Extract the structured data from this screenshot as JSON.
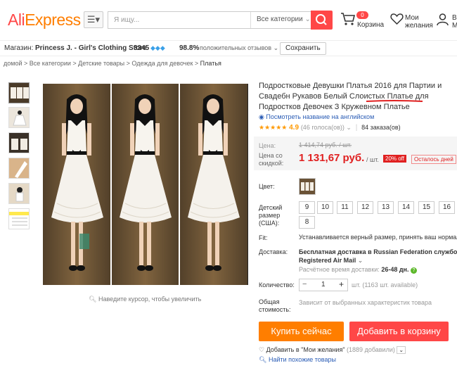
{
  "header": {
    "logo": "AliExpress",
    "search_placeholder": "Я ищу...",
    "category_select": "Все категории",
    "cart_count": "0",
    "cart_label": "Корзина",
    "wishlist_label_1": "Мои",
    "wishlist_label_2": "желания",
    "account_label_1": "В",
    "account_label_2": "М",
    "brand_color": "#ff4747"
  },
  "store": {
    "prefix": "Магазин:",
    "name": "Princess J. - Girl's Clothing Store",
    "score": "3345",
    "positive": "98.8%",
    "positive_label": "положительных отзывов",
    "save_label": "Сохранить"
  },
  "breadcrumb": [
    "домой",
    "Все категории",
    "Детские товары",
    "Одежда для девочек",
    "Платья"
  ],
  "gallery": {
    "hint": "Наведите курсор, чтобы увеличить"
  },
  "product": {
    "title": "Подростковые Девушки Платья 2016 для Партии и Свадебн Рукавов Белый Слоистых Платье для Подростков Девочек З Кружевном Платье",
    "translate_link": "Посмотреть название на английском",
    "stars": "★★★★★",
    "rating": "4.9",
    "votes": "(46 голоса(ов))",
    "orders": "84 заказа(ов)",
    "price_label": "Цена:",
    "old_price": "1 414,74 руб. / шт.",
    "discount_label_1": "Цена со",
    "discount_label_2": "скидкой:",
    "price": "1 131,67 руб.",
    "price_unit": "/ шт.",
    "discount_badge": "20% off",
    "time_left": "Осталось дней",
    "color_label": "Цвет:",
    "size_label_1": "Детский",
    "size_label_2": "размер",
    "size_label_3": "(США):",
    "sizes": [
      "9",
      "10",
      "11",
      "12",
      "13",
      "14",
      "15",
      "16",
      "8"
    ],
    "fit_label": "Fit:",
    "fit_value": "Устанавливается верный размер, принять ваш нормал",
    "shipping_label": "Доставка:",
    "shipping_value_1": "Бесплатная доставка в Russian Federation службой",
    "shipping_value_2": "Registered Air Mail",
    "delivery_label": "Расчётное время доставки:",
    "delivery_value": "26-48 дн.",
    "qty_label": "Количество:",
    "qty_value": "1",
    "qty_minus": "−",
    "qty_plus": "+",
    "qty_available": "шт. (1163 шт. available)",
    "total_label_1": "Общая",
    "total_label_2": "стоимость:",
    "total_value": "Зависит от выбранных характеристик товара",
    "buy_now": "Купить сейчас",
    "add_to_cart": "Добавить в корзину",
    "wishlist_add": "Добавить в \"Мои желания\"",
    "wishlist_count": "(1889 добавили)",
    "similar": "Найти похожие товары"
  }
}
